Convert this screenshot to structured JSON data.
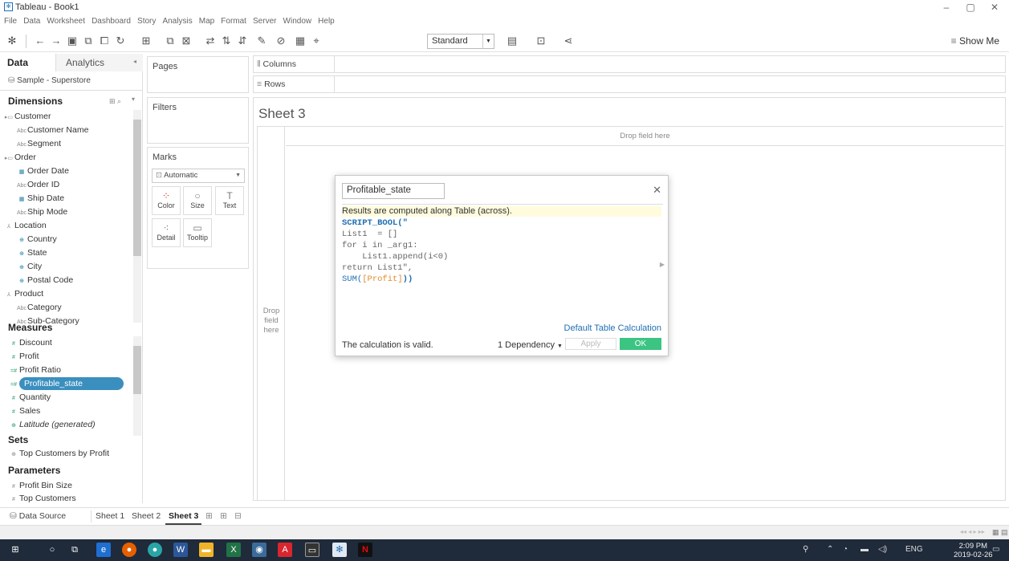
{
  "window": {
    "title": "Tableau - Book1"
  },
  "menu": [
    "File",
    "Data",
    "Worksheet",
    "Dashboard",
    "Story",
    "Analysis",
    "Map",
    "Format",
    "Server",
    "Window",
    "Help"
  ],
  "toolbar": {
    "fit": "Standard",
    "show_me": "Show Me"
  },
  "data_pane": {
    "tab_data": "Data",
    "tab_analytics": "Analytics",
    "datasource": "Sample - Superstore",
    "dimensions_label": "Dimensions",
    "dimensions": [
      {
        "label": "Customer",
        "type": "folder",
        "indent": 0
      },
      {
        "label": "Customer Name",
        "type": "abc",
        "indent": 1
      },
      {
        "label": "Segment",
        "type": "abc",
        "indent": 1
      },
      {
        "label": "Order",
        "type": "folder",
        "indent": 0
      },
      {
        "label": "Order Date",
        "type": "date",
        "indent": 1
      },
      {
        "label": "Order ID",
        "type": "abc",
        "indent": 1
      },
      {
        "label": "Ship Date",
        "type": "date",
        "indent": 1
      },
      {
        "label": "Ship Mode",
        "type": "abc",
        "indent": 1
      },
      {
        "label": "Location",
        "type": "hier",
        "indent": 0
      },
      {
        "label": "Country",
        "type": "geo",
        "indent": 1
      },
      {
        "label": "State",
        "type": "geo",
        "indent": 1
      },
      {
        "label": "City",
        "type": "geo",
        "indent": 1
      },
      {
        "label": "Postal Code",
        "type": "geo",
        "indent": 1
      },
      {
        "label": "Product",
        "type": "hier",
        "indent": 0
      },
      {
        "label": "Category",
        "type": "abc",
        "indent": 1
      },
      {
        "label": "Sub-Category",
        "type": "abc",
        "indent": 1
      }
    ],
    "measures_label": "Measures",
    "measures": [
      {
        "label": "Discount",
        "type": "num"
      },
      {
        "label": "Profit",
        "type": "num"
      },
      {
        "label": "Profit Ratio",
        "type": "calc"
      },
      {
        "label": "Profitable_state",
        "type": "calc",
        "selected": true
      },
      {
        "label": "Quantity",
        "type": "num"
      },
      {
        "label": "Sales",
        "type": "num"
      },
      {
        "label": "Latitude (generated)",
        "type": "geo",
        "italic": true
      }
    ],
    "sets_label": "Sets",
    "sets": [
      "Top Customers by Profit"
    ],
    "parameters_label": "Parameters",
    "parameters": [
      "Profit Bin Size",
      "Top Customers"
    ]
  },
  "cards": {
    "pages": "Pages",
    "filters": "Filters",
    "marks": "Marks",
    "mark_type": "Automatic",
    "mark_buttons": [
      {
        "label": "Color",
        "glyph": "⁘"
      },
      {
        "label": "Size",
        "glyph": "○"
      },
      {
        "label": "Text",
        "glyph": "T"
      },
      {
        "label": "Detail",
        "glyph": "⁖"
      },
      {
        "label": "Tooltip",
        "glyph": "▭"
      }
    ]
  },
  "shelves": {
    "columns": "Columns",
    "rows": "Rows"
  },
  "sheet": {
    "title": "Sheet 3",
    "drop_field_top": "Drop field here",
    "drop_field_left_1": "Drop",
    "drop_field_left_2": "field",
    "drop_field_left_3": "here"
  },
  "calc_dialog": {
    "name": "Profitable_state",
    "note": "Results are computed along Table (across).",
    "code_line1_fn": "SCRIPT_BOOL(\"",
    "code_line2": "List1  = []",
    "code_line3": "for i in _arg1:",
    "code_line4": "    List1.append(i<0)",
    "code_line5": "return List1\",",
    "code_line6_fn": "SUM(",
    "code_line6_field": "[Profit]",
    "code_line6_end": "))",
    "default_table_calc": "Default Table Calculation",
    "valid": "The calculation is valid.",
    "dependency": "1 Dependency",
    "apply": "Apply",
    "ok": "OK"
  },
  "sheet_tabs": {
    "datasource": "Data Source",
    "tabs": [
      "Sheet 1",
      "Sheet 2",
      "Sheet 3"
    ],
    "active": "Sheet 3"
  },
  "taskbar": {
    "lang": "ENG",
    "time": "2:09 PM",
    "date": "2019-02-26"
  },
  "colors": {
    "accent_blue": "#1f6fb2",
    "selected_pill": "#3b8fbf",
    "ok_green": "#3cc482",
    "taskbar": "#1f2a3a"
  }
}
